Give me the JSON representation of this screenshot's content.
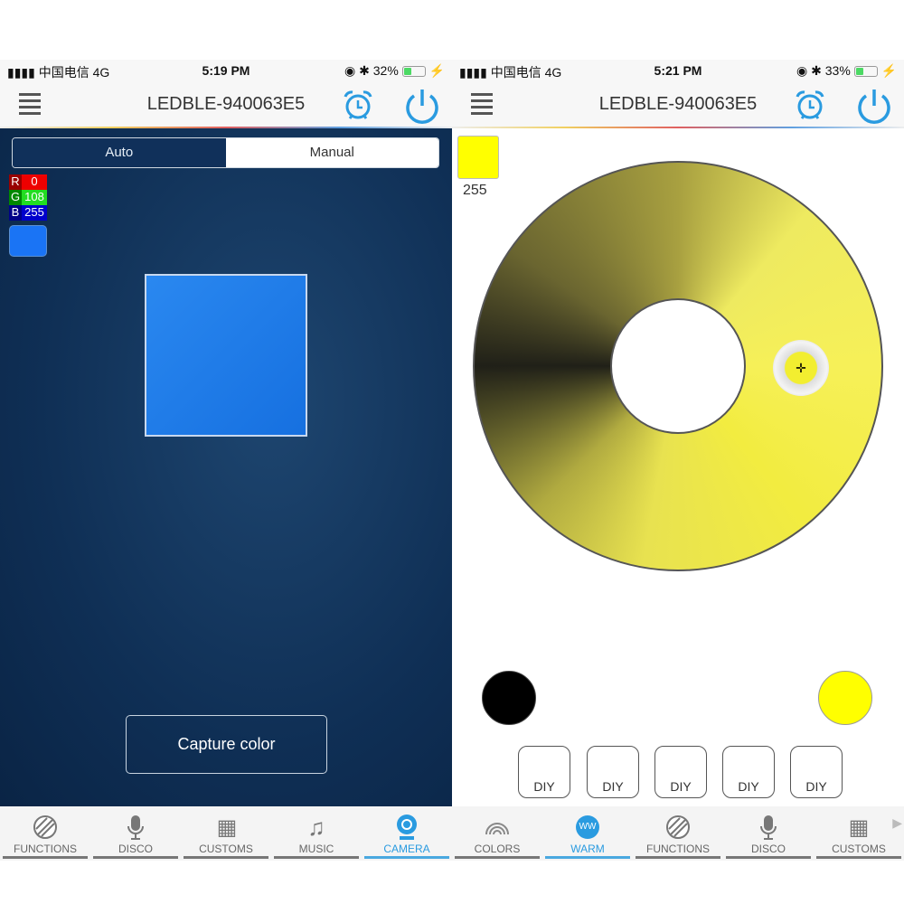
{
  "left": {
    "status": {
      "carrier": "中国电信  4G",
      "time": "5:19 PM",
      "battery": "32%",
      "battery_level": 0.32
    },
    "header": {
      "title": "LEDBLE-940063E5"
    },
    "mode": {
      "auto": "Auto",
      "manual": "Manual",
      "selected": "Auto"
    },
    "rgb": {
      "r_label": "R",
      "r": "0",
      "g_label": "G",
      "g": "108",
      "b_label": "B",
      "b": "255"
    },
    "color": "#1a74f5",
    "capture": "Capture color",
    "tabs": [
      {
        "label": "FUNCTIONS"
      },
      {
        "label": "DISCO"
      },
      {
        "label": "CUSTOMS"
      },
      {
        "label": "MUSIC"
      },
      {
        "label": "CAMERA",
        "active": true
      }
    ]
  },
  "right": {
    "status": {
      "carrier": "中国电信  4G",
      "time": "5:21 PM",
      "battery": "33%",
      "battery_level": 0.33
    },
    "header": {
      "title": "LEDBLE-940063E5"
    },
    "swatch_value": "255",
    "swatch_color": "#ffff00",
    "diy": [
      "DIY",
      "DIY",
      "DIY",
      "DIY",
      "DIY"
    ],
    "tabs": [
      {
        "label": "COLORS"
      },
      {
        "label": "WARM",
        "active": true,
        "icon_text": "WW"
      },
      {
        "label": "FUNCTIONS"
      },
      {
        "label": "DISCO"
      },
      {
        "label": "CUSTOMS"
      }
    ]
  }
}
